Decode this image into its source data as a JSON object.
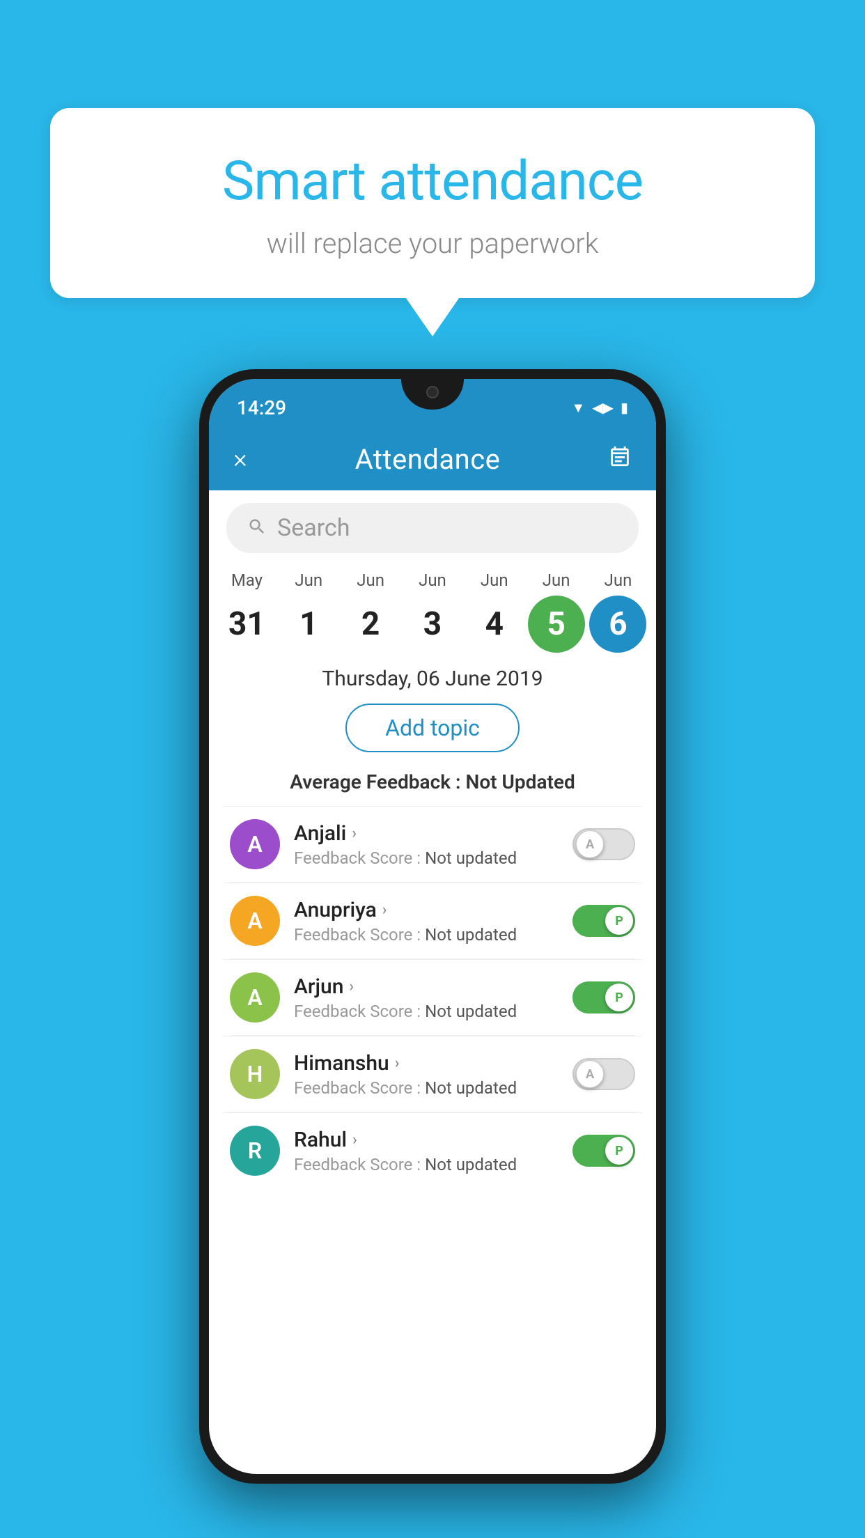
{
  "background_color": "#29b6e8",
  "speech_bubble": {
    "title": "Smart attendance",
    "subtitle": "will replace your paperwork"
  },
  "status_bar": {
    "time": "14:29",
    "icons": [
      "wifi",
      "signal",
      "battery"
    ]
  },
  "header": {
    "title": "Attendance",
    "close_label": "×",
    "calendar_icon": "📅"
  },
  "search": {
    "placeholder": "Search"
  },
  "date_selector": {
    "columns": [
      {
        "month": "May",
        "day": "31",
        "selected": ""
      },
      {
        "month": "Jun",
        "day": "1",
        "selected": ""
      },
      {
        "month": "Jun",
        "day": "2",
        "selected": ""
      },
      {
        "month": "Jun",
        "day": "3",
        "selected": ""
      },
      {
        "month": "Jun",
        "day": "4",
        "selected": ""
      },
      {
        "month": "Jun",
        "day": "5",
        "selected": "green"
      },
      {
        "month": "Jun",
        "day": "6",
        "selected": "blue"
      }
    ]
  },
  "selected_date": "Thursday, 06 June 2019",
  "add_topic_label": "Add topic",
  "avg_feedback_label": "Average Feedback :",
  "avg_feedback_value": "Not Updated",
  "students": [
    {
      "name": "Anjali",
      "initial": "A",
      "avatar_color": "#9c4dcc",
      "feedback_label": "Feedback Score :",
      "feedback_value": "Not updated",
      "toggle": "off",
      "toggle_letter": "A"
    },
    {
      "name": "Anupriya",
      "initial": "A",
      "avatar_color": "#f5a623",
      "feedback_label": "Feedback Score :",
      "feedback_value": "Not updated",
      "toggle": "on",
      "toggle_letter": "P"
    },
    {
      "name": "Arjun",
      "initial": "A",
      "avatar_color": "#8bc34a",
      "feedback_label": "Feedback Score :",
      "feedback_value": "Not updated",
      "toggle": "on",
      "toggle_letter": "P"
    },
    {
      "name": "Himanshu",
      "initial": "H",
      "avatar_color": "#a5c45a",
      "feedback_label": "Feedback Score :",
      "feedback_value": "Not updated",
      "toggle": "off",
      "toggle_letter": "A"
    },
    {
      "name": "Rahul",
      "initial": "R",
      "avatar_color": "#26a69a",
      "feedback_label": "Feedback Score :",
      "feedback_value": "Not updated",
      "toggle": "on",
      "toggle_letter": "P"
    }
  ]
}
